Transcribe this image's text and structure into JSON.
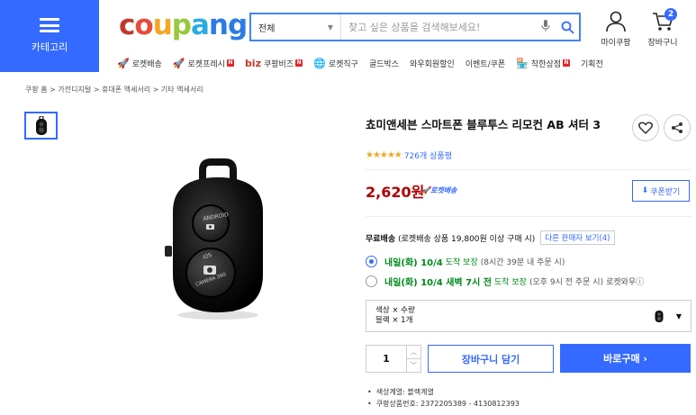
{
  "header": {
    "category_label": "카테고리",
    "logo": {
      "letters": [
        "c",
        "o",
        "u",
        "p",
        "a",
        "n",
        "g"
      ],
      "colors": [
        "#c0392b",
        "#e74c3c",
        "#f5a623",
        "#97c93c",
        "#2cabe3",
        "#2c7be5",
        "#2c7be5"
      ]
    },
    "search": {
      "category": "전체",
      "placeholder": "찾고 싶은 상품을 검색해보세요!"
    },
    "mycoupang_label": "마이쿠팡",
    "cart_label": "장바구니",
    "cart_count": "2"
  },
  "nav": {
    "items": [
      {
        "label": "로켓배송",
        "icon": "rocket-icon"
      },
      {
        "label": "로켓프레시",
        "icon": "rocket-fresh-icon",
        "badge": "N"
      },
      {
        "label": "쿠팡비즈",
        "prefix": "biz",
        "badge": "N"
      },
      {
        "label": "로켓직구",
        "icon": "global-icon"
      },
      {
        "label": "골드박스"
      },
      {
        "label": "와우회원할인"
      },
      {
        "label": "이벤트/쿠폰"
      },
      {
        "label": "착한상점",
        "icon": "store-icon",
        "badge": "N"
      },
      {
        "label": "기획전"
      }
    ]
  },
  "breadcrumb": "쿠팡 홈 > 가전디지털 > 휴대폰 액세서리 > 기타 액세서리",
  "product": {
    "title": "쵸미앤세븐 스마트폰 블루투스 리모컨 AB 셔터 3",
    "stars": "★★★★★",
    "reviews": "726개 상품평",
    "price": "2,620원",
    "rocket_tag": "로켓배송",
    "coupon_label": "쿠폰받기",
    "shipping": {
      "free": "무료배송",
      "condition": "(로켓배송 상품 19,800원 이상 구매 시)",
      "other_sellers": "다른 판매자 보기(4)"
    },
    "delivery": [
      {
        "selected": true,
        "date": "내일(화) 10/4",
        "label": "도착 보장",
        "note": "(8시간 39분 내 주문 시)",
        "extra": ""
      },
      {
        "selected": false,
        "date": "내일(화) 10/4 새벽 7시 전",
        "label": "도착 보장",
        "note": "(오후 9시 전 주문 시)",
        "extra": "로켓와우ⓘ"
      }
    ],
    "option": {
      "line1": "색상 × 수량",
      "line2": "블랙 × 1개"
    },
    "quantity": "1",
    "add_cart_label": "장바구니 담기",
    "buy_now_label": "바로구매 ›",
    "specs": [
      "색상계열: 블랙계열",
      "쿠팡상품번호: 2372205389 - 4130812393"
    ]
  },
  "colors": {
    "accent": "#346aff",
    "price": "#ae0000",
    "delivery": "#00891a"
  }
}
